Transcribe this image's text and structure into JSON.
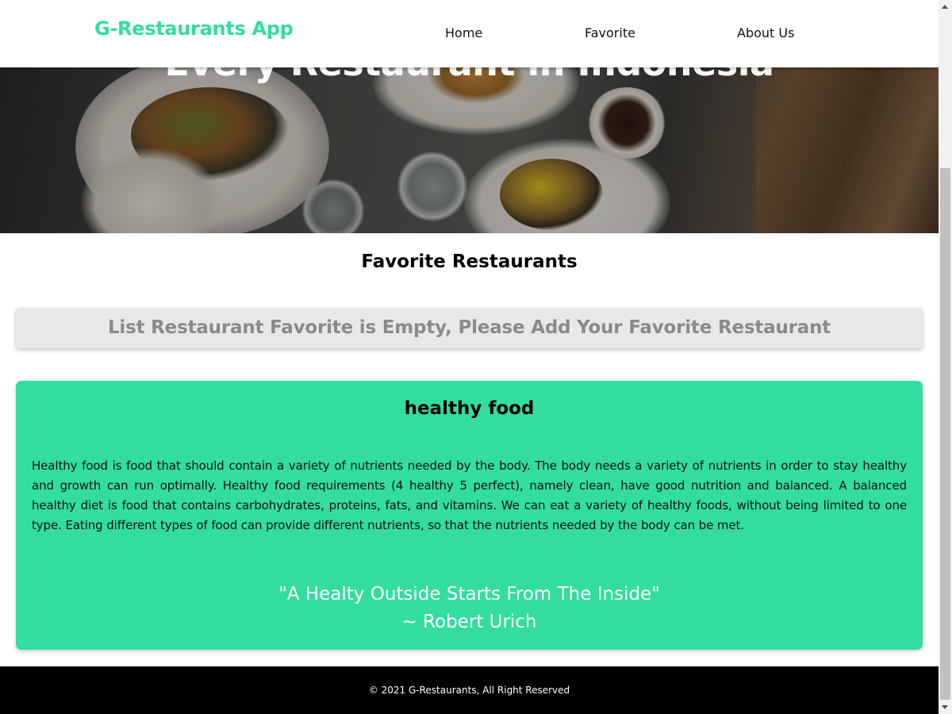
{
  "navbar": {
    "brand": "G-Restaurants App",
    "links": [
      "Home",
      "Favorite",
      "About Us"
    ]
  },
  "hero": {
    "title": "Every Restaurant in Indonesia"
  },
  "favorites": {
    "heading": "Favorite Restaurants",
    "empty_message": "List Restaurant Favorite is Empty, Please Add Your Favorite Restaurant"
  },
  "info": {
    "title": "healthy food",
    "body": "Healthy food is food that should contain a variety of nutrients needed by the body. The body needs a variety of nutrients in order to stay healthy and growth can run optimally. Healthy food requirements (4 healthy 5 perfect), namely clean, have good nutrition and balanced. A balanced healthy diet is food that contains carbohydrates, proteins, fats, and vitamins. We can eat a variety of healthy foods, without being limited to one type. Eating different types of food can provide different nutrients, so that the nutrients needed by the body can be met.",
    "quote": "\"A Healty Outside Starts From The Inside\"",
    "quote_author": "~ Robert Urich"
  },
  "footer": {
    "text": "© 2021 G-Restaurants, All Right Reserved"
  },
  "colors": {
    "accent": "#33dd9f",
    "empty_box": "#e8e8e8",
    "footer": "#000000"
  }
}
